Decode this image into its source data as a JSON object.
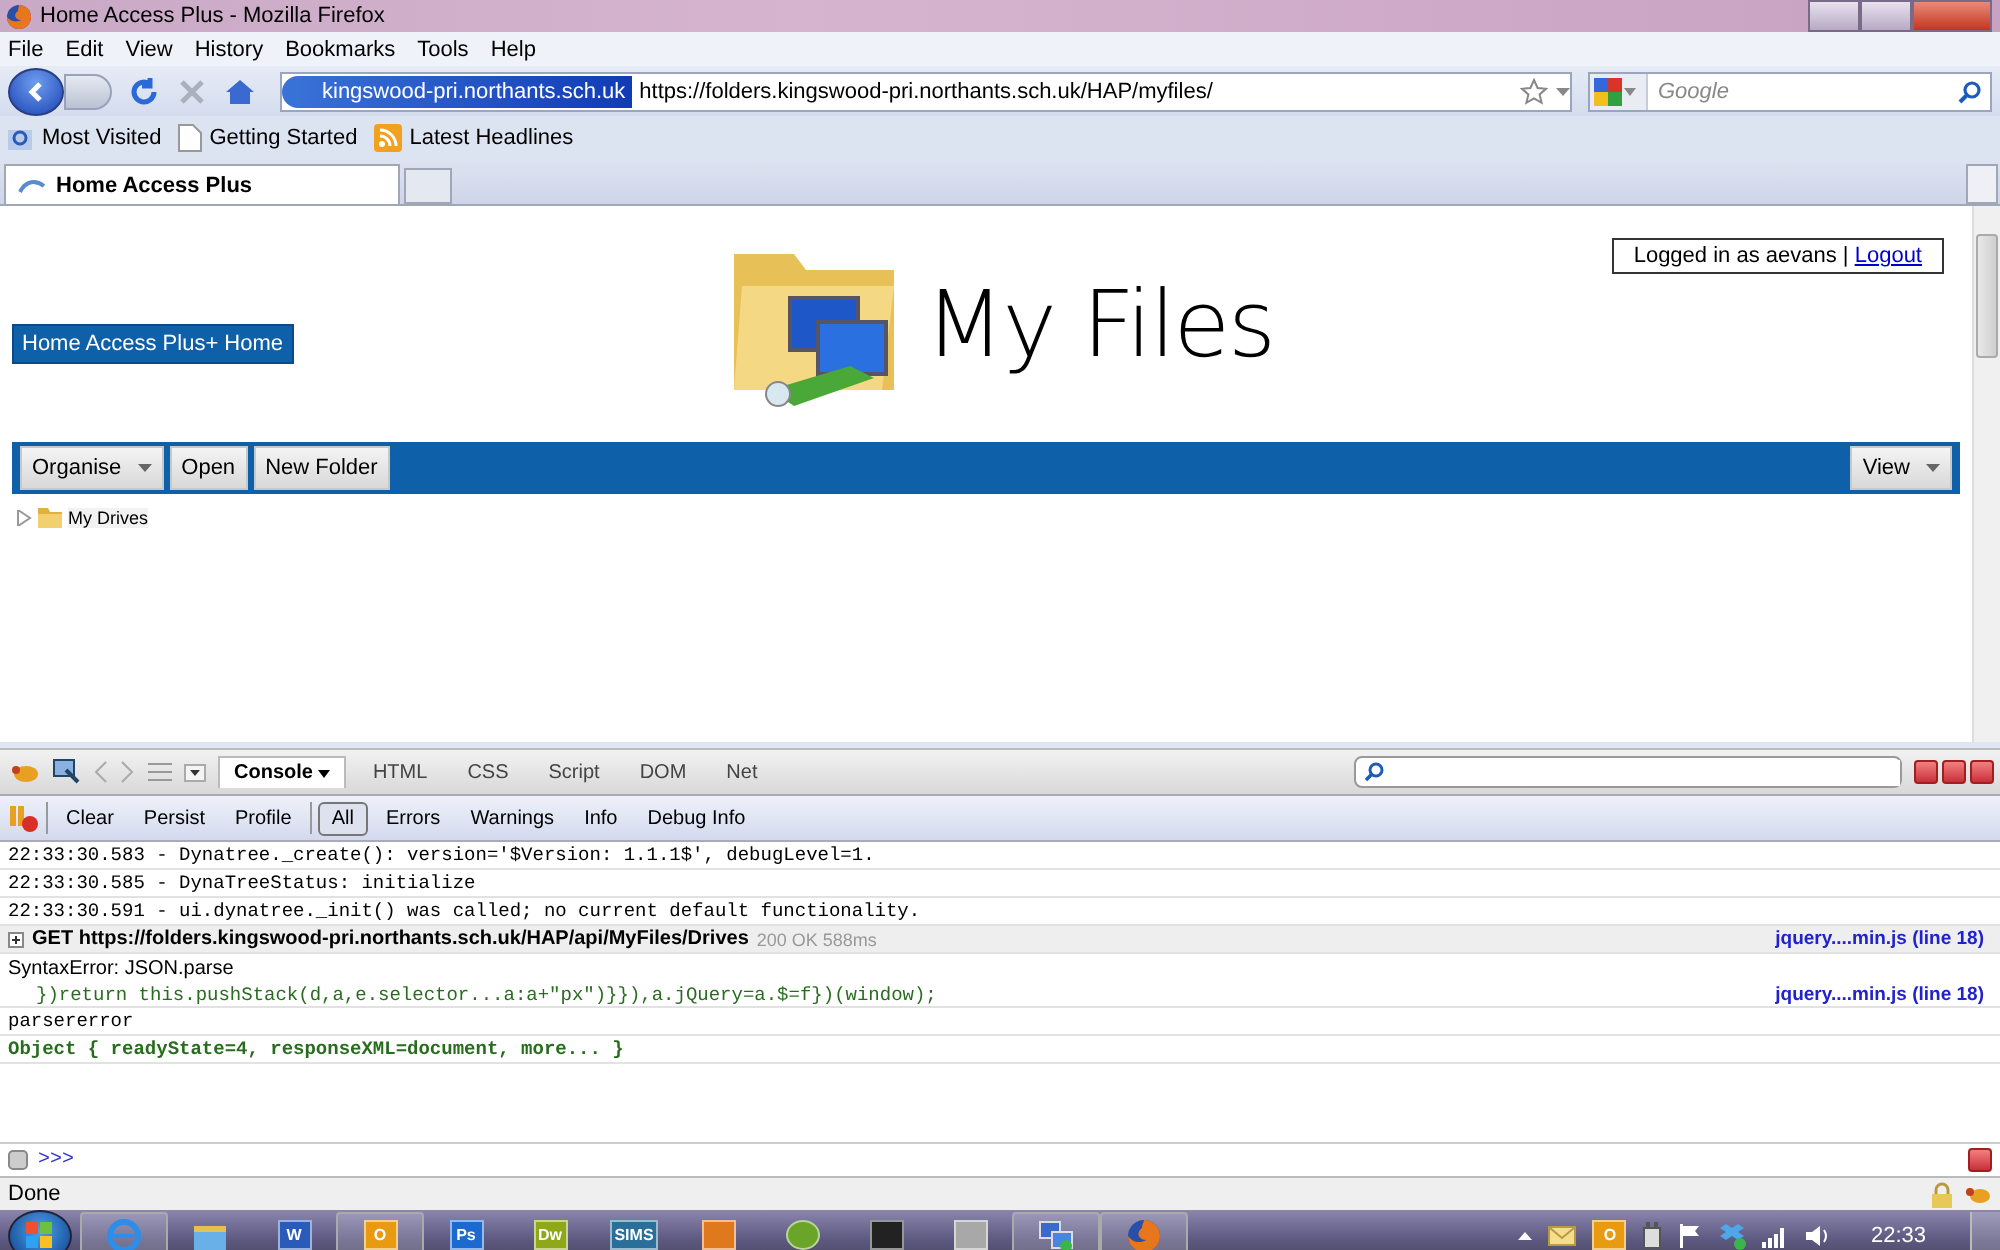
{
  "window": {
    "title": "Home Access Plus - Mozilla Firefox"
  },
  "menu": [
    "File",
    "Edit",
    "View",
    "History",
    "Bookmarks",
    "Tools",
    "Help"
  ],
  "address": {
    "site_badge": "kingswood-pri.northants.sch.uk",
    "url": "https://folders.kingswood-pri.northants.sch.uk/HAP/myfiles/"
  },
  "search": {
    "placeholder": "Google"
  },
  "bookmarks": [
    {
      "label": "Most Visited",
      "kind": "smart"
    },
    {
      "label": "Getting Started",
      "kind": "page"
    },
    {
      "label": "Latest Headlines",
      "kind": "feed"
    }
  ],
  "tabs": [
    {
      "label": "Home Access Plus",
      "selected": true
    }
  ],
  "page": {
    "login": {
      "text": "Logged in as aevans",
      "separator": "|",
      "link": "Logout"
    },
    "home_link": "Home Access Plus+ Home",
    "heading": "My Files",
    "toolbar_left": [
      {
        "label": "Organise",
        "dropdown": true
      },
      {
        "label": "Open",
        "dropdown": false
      },
      {
        "label": "New Folder",
        "dropdown": false
      }
    ],
    "toolbar_right": [
      {
        "label": "View",
        "dropdown": true
      }
    ],
    "tree": [
      {
        "label": "My Drives",
        "expanded": false
      }
    ]
  },
  "firebug": {
    "tabs": [
      {
        "label": "Console",
        "selected": true,
        "dropdown": true
      },
      {
        "label": "HTML",
        "selected": false,
        "dropdown": false
      },
      {
        "label": "CSS",
        "selected": false,
        "dropdown": false
      },
      {
        "label": "Script",
        "selected": false,
        "dropdown": false
      },
      {
        "label": "DOM",
        "selected": false,
        "dropdown": false
      },
      {
        "label": "Net",
        "selected": false,
        "dropdown": false
      }
    ],
    "actions": [
      "Clear",
      "Persist",
      "Profile"
    ],
    "filters": [
      {
        "label": "All",
        "selected": true
      },
      {
        "label": "Errors",
        "selected": false
      },
      {
        "label": "Warnings",
        "selected": false
      },
      {
        "label": "Info",
        "selected": false
      },
      {
        "label": "Debug Info",
        "selected": false
      }
    ],
    "log": [
      {
        "kind": "plain",
        "text": "22:33:30.583 - Dynatree._create(): version='$Version: 1.1.1$', debugLevel=1."
      },
      {
        "kind": "plain",
        "text": "22:33:30.585 - DynaTreeStatus: initialize"
      },
      {
        "kind": "plain",
        "text": "22:33:30.591 - ui.dynatree._init() was called; no current default functionality."
      },
      {
        "kind": "request",
        "text": "GET https://folders.kingswood-pri.northants.sch.uk/HAP/api/MyFiles/Drives",
        "status": "200 OK 588ms",
        "source": "jquery....min.js (line 18)"
      },
      {
        "kind": "error",
        "text": "SyntaxError: JSON.parse",
        "code": "})return this.pushStack(d,a,e.selector...a:a+\"px\")}}),a.jQuery=a.$=f})(window);",
        "source": "jquery....min.js (line 18)"
      },
      {
        "kind": "plain",
        "text": "parsererror"
      },
      {
        "kind": "object",
        "text": "Object { readyState=4, responseXML=document, more... }"
      }
    ],
    "prompt": ">>>"
  },
  "status_bar": "Done",
  "taskbar": {
    "apps": [
      {
        "kind": "ie"
      },
      {
        "kind": "folder"
      },
      {
        "kind": "tile",
        "label": "W",
        "color": "#2a5bb8"
      },
      {
        "kind": "tile",
        "label": "O",
        "color": "#e89a10"
      },
      {
        "kind": "tile",
        "label": "Ps",
        "color": "#1c6ad0"
      },
      {
        "kind": "tile",
        "label": "Dw",
        "color": "#8fa81a"
      },
      {
        "kind": "tile",
        "label": "SIMS",
        "color": "#2a6f9a"
      },
      {
        "kind": "square",
        "color": "#e0781e"
      },
      {
        "kind": "round",
        "color": "#6aa52a"
      },
      {
        "kind": "square",
        "color": "#222222"
      },
      {
        "kind": "square",
        "color": "#a8a8a8"
      },
      {
        "kind": "network"
      },
      {
        "kind": "firefox"
      }
    ],
    "tray": [
      {
        "kind": "mail"
      },
      {
        "kind": "tile",
        "label": "O",
        "color": "#e89a10"
      },
      {
        "kind": "plug"
      },
      {
        "kind": "flag"
      },
      {
        "kind": "box"
      },
      {
        "kind": "signal"
      },
      {
        "kind": "speaker"
      }
    ],
    "clock": "22:33"
  }
}
